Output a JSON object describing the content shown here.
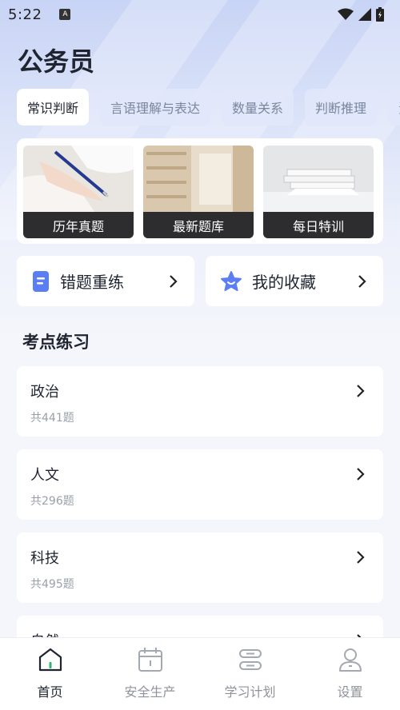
{
  "status_bar": {
    "time": "5:22",
    "app_icon": "A"
  },
  "header": {
    "title": "公务员"
  },
  "tabs": [
    {
      "label": "常识判断",
      "active": true
    },
    {
      "label": "言语理解与表达",
      "active": false
    },
    {
      "label": "数量关系",
      "active": false
    },
    {
      "label": "判断推理",
      "active": false
    },
    {
      "label": "资",
      "active": false
    }
  ],
  "banners": [
    {
      "label": "历年真题",
      "icon": "writing-photo"
    },
    {
      "label": "最新题库",
      "icon": "library-photo"
    },
    {
      "label": "每日特训",
      "icon": "books-photo"
    }
  ],
  "quick_actions": [
    {
      "label": "错题重练",
      "icon": "document-icon"
    },
    {
      "label": "我的收藏",
      "icon": "star-icon"
    }
  ],
  "section": {
    "title": "考点练习"
  },
  "topics": [
    {
      "name": "政治",
      "count": "共441题"
    },
    {
      "name": "人文",
      "count": "共296题"
    },
    {
      "name": "科技",
      "count": "共495题"
    },
    {
      "name": "自然",
      "count": ""
    }
  ],
  "bottom_nav": [
    {
      "label": "首页",
      "icon": "home-icon",
      "active": true
    },
    {
      "label": "安全生产",
      "icon": "calendar-icon",
      "active": false
    },
    {
      "label": "学习计划",
      "icon": "plan-icon",
      "active": false
    },
    {
      "label": "设置",
      "icon": "user-icon",
      "active": false
    }
  ],
  "colors": {
    "accent": "#4f6ef0",
    "nav_active": "#1f2430",
    "nav_inactive": "#8f939b"
  }
}
